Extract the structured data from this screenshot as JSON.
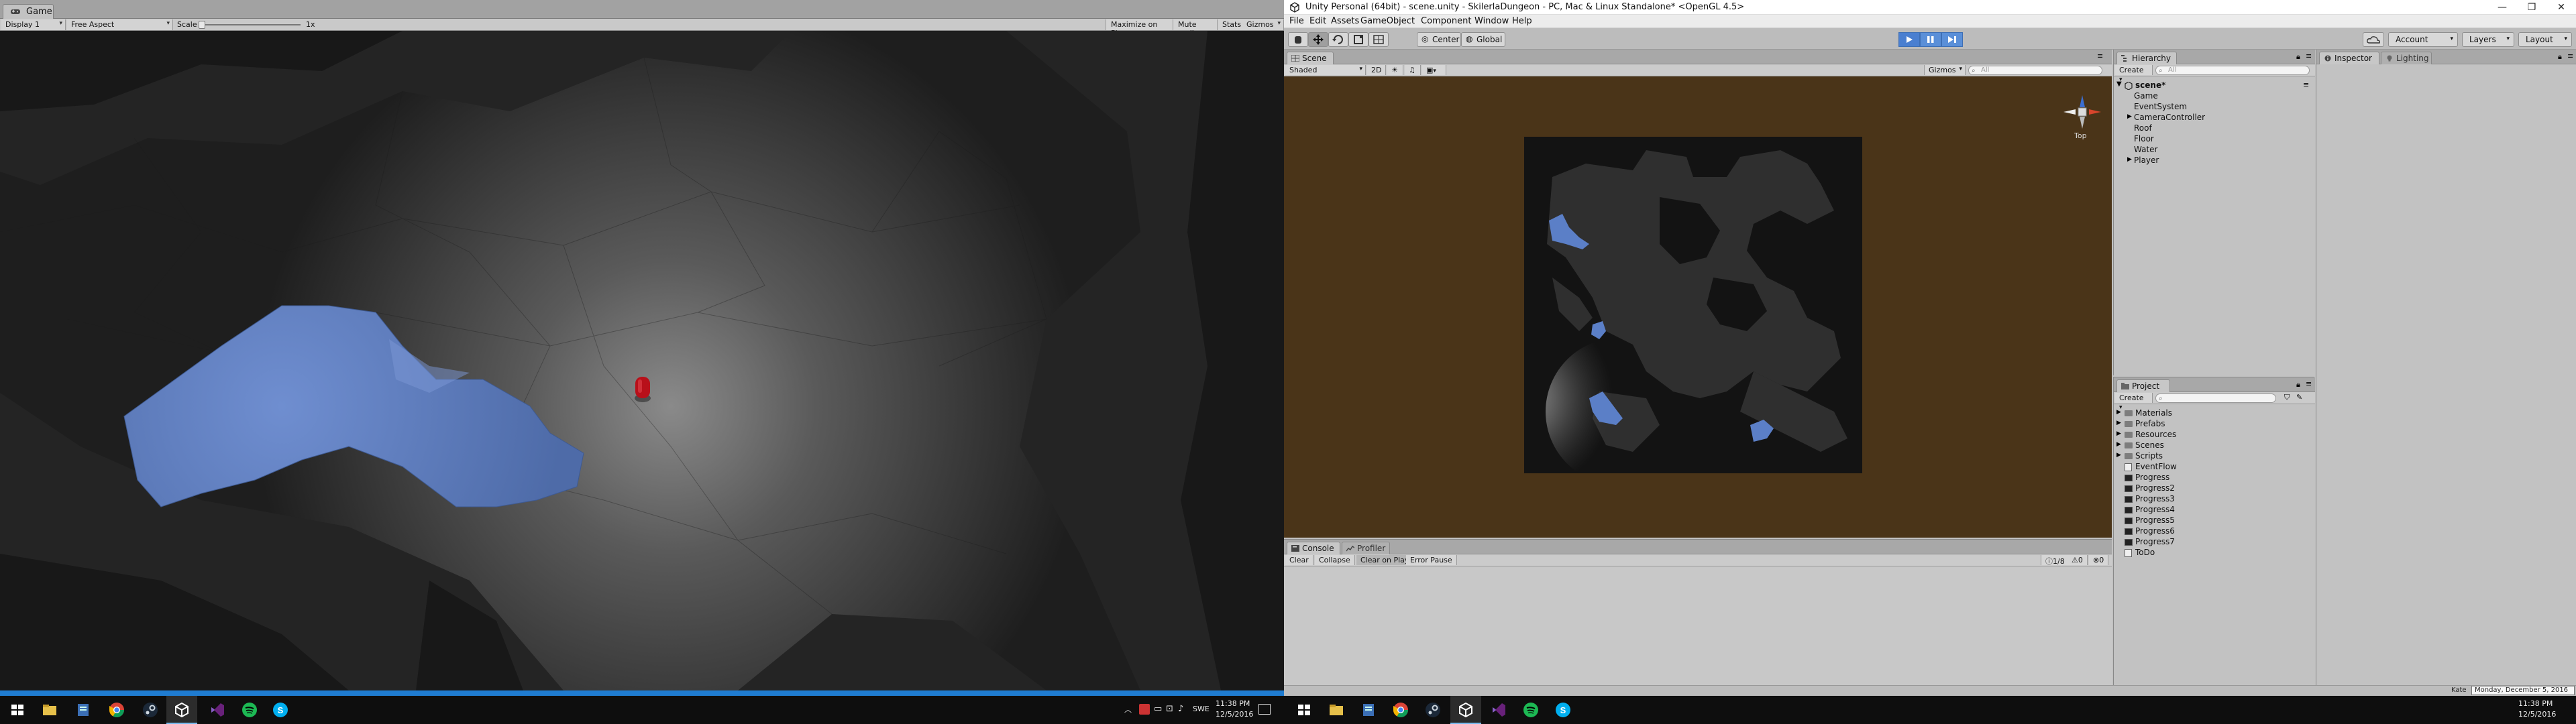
{
  "game_window": {
    "tab_label": "Game",
    "toolbar": {
      "display": "Display 1",
      "aspect": "Free Aspect",
      "scale_label": "Scale",
      "scale_value": "1x",
      "maximize_on_play": "Maximize on Play",
      "mute_audio": "Mute audio",
      "stats": "Stats",
      "gizmos": "Gizmos"
    },
    "colors": {
      "water": "#5b7fc7",
      "player_capsule": "#c0121a",
      "rock": "#3c3c3c"
    }
  },
  "left_taskbar": {
    "icons": [
      "windows-start-icon",
      "file-explorer-icon",
      "notepad-icon",
      "chrome-icon",
      "steam-icon",
      "unity-icon",
      "visual-studio-icon",
      "spotify-icon",
      "skype-icon"
    ],
    "tray_lang": "SWE",
    "clock_time": "11:38 PM",
    "clock_date": "12/5/2016"
  },
  "editor": {
    "window_title": "Unity Personal (64bit) - scene.unity - SkilerlaDungeon - PC, Mac & Linux Standalone* <OpenGL 4.5>",
    "menu": [
      "File",
      "Edit",
      "Assets",
      "GameObject",
      "Component",
      "Window",
      "Help"
    ],
    "toolbar": {
      "pivot": "Center",
      "space": "Global",
      "account": "Account",
      "layers": "Layers",
      "layout": "Layout"
    },
    "scene_panel": {
      "tab": "Scene",
      "shading": "Shaded",
      "mode_2d": "2D",
      "gizmos": "Gizmos",
      "search_placeholder": "All",
      "gizmo_label": "Top",
      "colors": {
        "background": "#4a3418",
        "water": "#5b7fc7"
      }
    },
    "console_panel": {
      "tabs": [
        "Console",
        "Profiler"
      ],
      "buttons": [
        "Clear",
        "Collapse",
        "Clear on Play",
        "Error Pause"
      ],
      "count_log": "1/8",
      "count_warn": "0",
      "count_error": "0"
    },
    "hierarchy_panel": {
      "tab": "Hierarchy",
      "create": "Create",
      "search_placeholder": "All",
      "scene_name": "scene*",
      "items": [
        "Game",
        "EventSystem",
        "CameraController",
        "Roof",
        "Floor",
        "Water",
        "Player"
      ]
    },
    "project_panel": {
      "tab": "Project",
      "create": "Create",
      "folders": [
        "Materials",
        "Prefabs",
        "Resources",
        "Scenes",
        "Scripts"
      ],
      "files": [
        "EventFlow",
        "Progress",
        "Progress2",
        "Progress3",
        "Progress4",
        "Progress5",
        "Progress6",
        "Progress7",
        "ToDo"
      ]
    },
    "inspector_panel": {
      "tabs": [
        "Inspector",
        "Lighting"
      ]
    }
  },
  "right_taskbar": {
    "icons": [
      "windows-start-icon",
      "file-explorer-icon",
      "notepad-icon",
      "chrome-icon",
      "steam-icon",
      "unity-icon",
      "visual-studio-icon",
      "spotify-icon",
      "skype-icon"
    ],
    "clock_time": "11:38 PM",
    "clock_date": "12/5/2016",
    "date_tooltip": "Monday, December 5, 2016",
    "status_left": "Kate"
  }
}
